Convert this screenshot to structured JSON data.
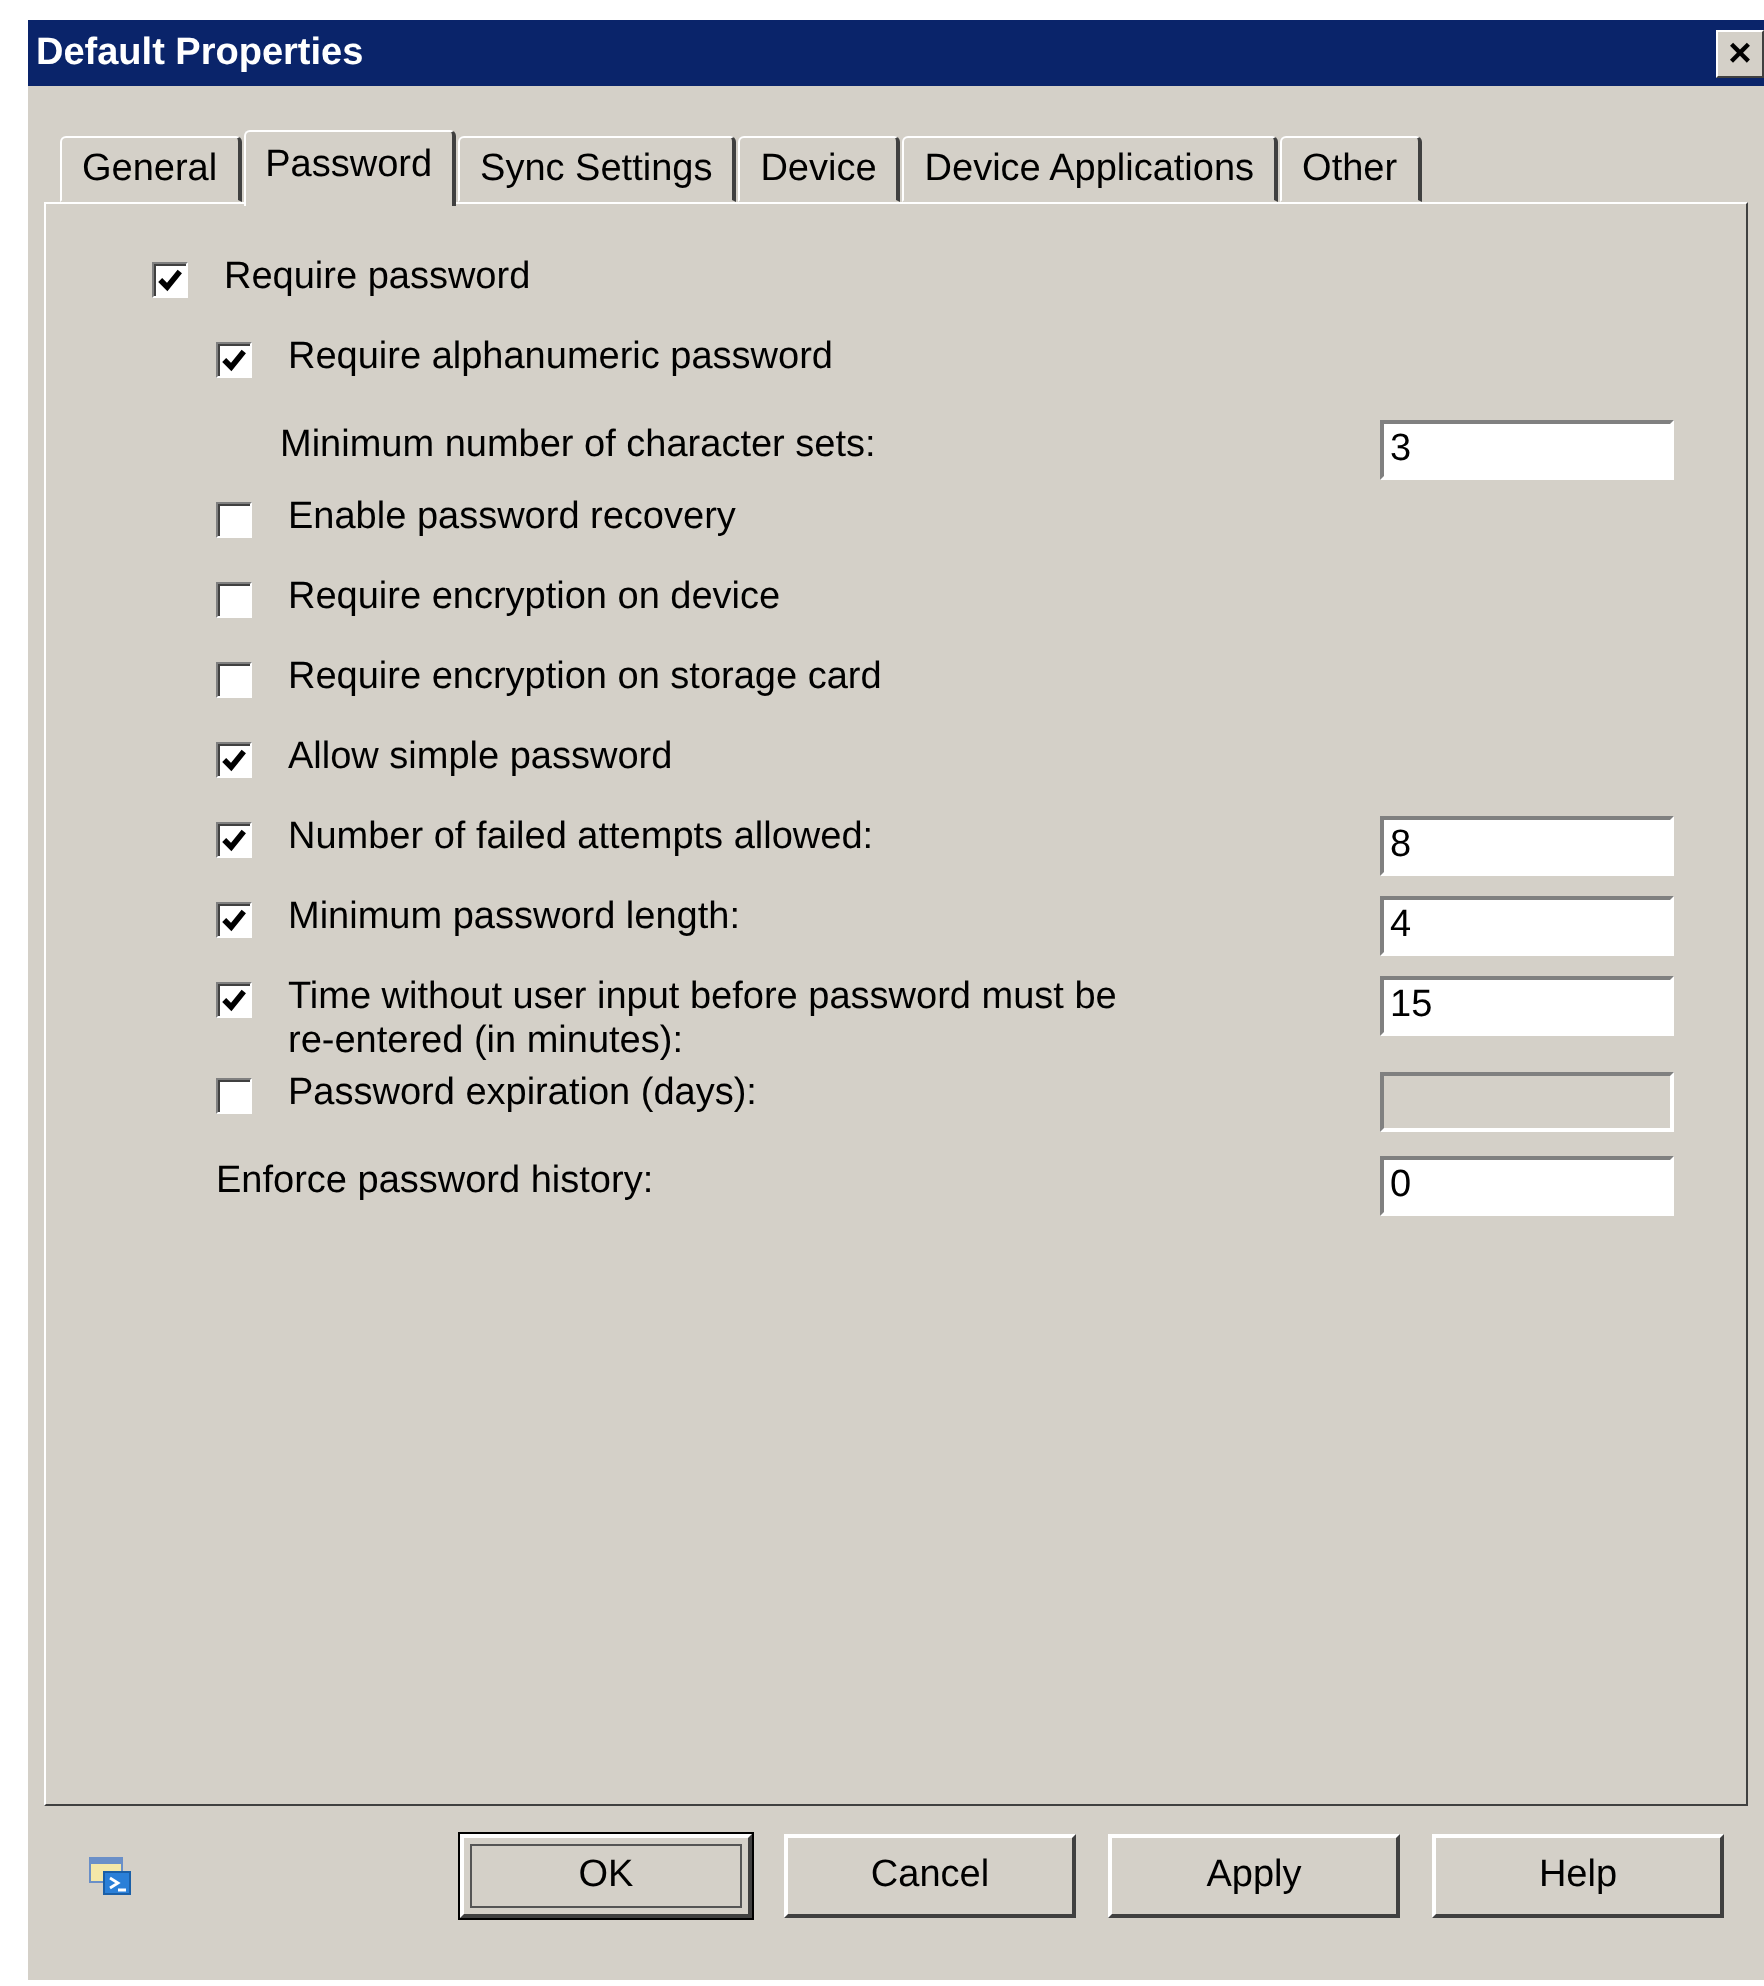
{
  "window": {
    "title": "Default Properties",
    "close": "×"
  },
  "tabs": [
    {
      "label": "General",
      "selected": false
    },
    {
      "label": "Password",
      "selected": true
    },
    {
      "label": "Sync Settings",
      "selected": false
    },
    {
      "label": "Device",
      "selected": false
    },
    {
      "label": "Device Applications",
      "selected": false
    },
    {
      "label": "Other",
      "selected": false
    }
  ],
  "options": [
    {
      "kind": "checkbox",
      "label": "Require password",
      "checked": true,
      "children": [
        {
          "kind": "checkbox",
          "label": "Require alphanumeric password",
          "checked": true,
          "children": [
            {
              "kind": "label",
              "label": "Minimum number of character sets:",
              "field": {
                "value": "3",
                "disabled": false
              }
            }
          ]
        },
        {
          "kind": "checkbox",
          "label": "Enable password recovery",
          "checked": false
        },
        {
          "kind": "checkbox",
          "label": "Require encryption on device",
          "checked": false
        },
        {
          "kind": "checkbox",
          "label": "Require encryption on storage card",
          "checked": false
        },
        {
          "kind": "checkbox",
          "label": "Allow simple password",
          "checked": true
        },
        {
          "kind": "checkbox",
          "label": "Number of failed attempts allowed:",
          "checked": true,
          "field": {
            "value": "8",
            "disabled": false
          }
        },
        {
          "kind": "checkbox",
          "label": "Minimum password length:",
          "checked": true,
          "field": {
            "value": "4",
            "disabled": false
          }
        },
        {
          "kind": "checkbox",
          "label": "Time without user input before password must be re-entered (in minutes):",
          "checked": true,
          "field": {
            "value": "15",
            "disabled": false
          }
        },
        {
          "kind": "checkbox",
          "label": "Password expiration (days):",
          "checked": false,
          "field": {
            "disabled": true
          }
        },
        {
          "kind": "label",
          "label": "Enforce password history:",
          "field": {
            "value": "0",
            "disabled": false
          }
        }
      ]
    }
  ],
  "buttons": [
    {
      "label": "OK",
      "default": true
    },
    {
      "label": "Cancel",
      "default": false
    },
    {
      "label": "Apply",
      "default": false
    },
    {
      "label": "Help",
      "default": false
    }
  ]
}
